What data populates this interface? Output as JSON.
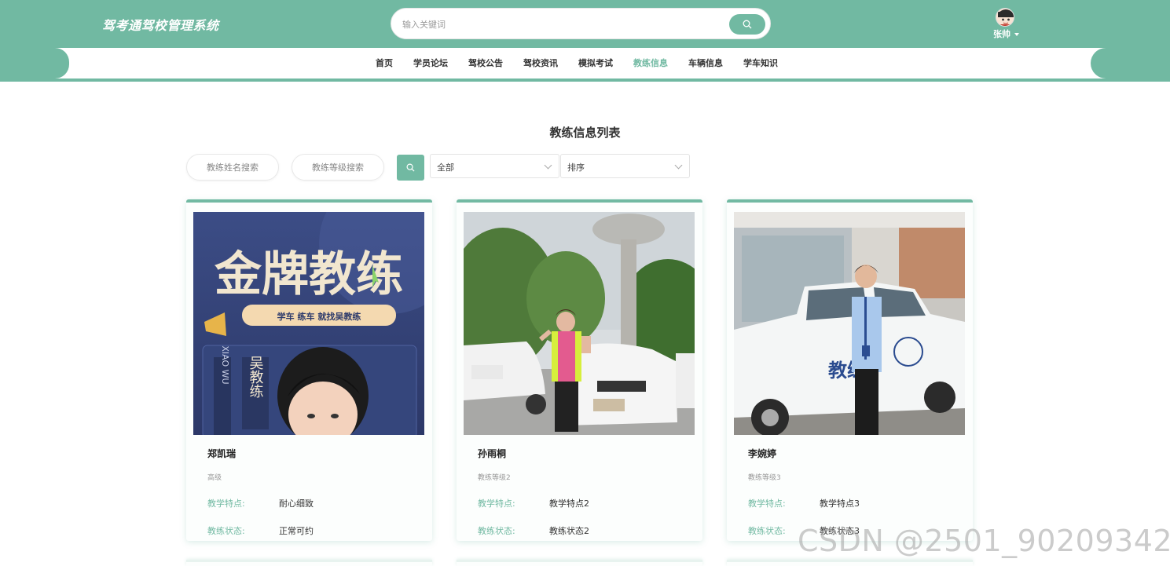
{
  "header": {
    "logo": "驾考通驾校管理系统",
    "search_placeholder": "输入关键词",
    "username": "张帅",
    "colors": {
      "primary": "#71b9a2",
      "background": "#ffffff"
    }
  },
  "nav": {
    "items": [
      {
        "label": "首页"
      },
      {
        "label": "学员论坛"
      },
      {
        "label": "驾校公告"
      },
      {
        "label": "驾校资讯"
      },
      {
        "label": "模拟考试"
      },
      {
        "label": "教练信息"
      },
      {
        "label": "车辆信息"
      },
      {
        "label": "学车知识"
      }
    ],
    "active": "教练信息"
  },
  "main": {
    "title": "教练信息列表",
    "filters": {
      "name_placeholder": "教练姓名搜索",
      "level_placeholder": "教练等级搜索",
      "select_all": "全部",
      "select_sort": "排序"
    },
    "cards": [
      {
        "name": "郑凯瑞",
        "level": "高级",
        "feature_label": "教学特点:",
        "feature": "耐心细致",
        "status_label": "教练状态:",
        "status": "正常可约",
        "photo": {
          "headline": "金牌教练",
          "slogan": "学车 练车 就找吴教练",
          "name_vertical": "吴教练",
          "pinyin": "XIAO WU"
        }
      },
      {
        "name": "孙雨桐",
        "level": "教练等级2",
        "feature_label": "教学特点:",
        "feature": "教学特点2",
        "status_label": "教练状态:",
        "status": "教练状态2"
      },
      {
        "name": "李婉婷",
        "level": "教练等级3",
        "feature_label": "教学特点:",
        "feature": "教学特点3",
        "status_label": "教练状态:",
        "status": "教练状态3",
        "photo": {
          "truck_text": "教练"
        }
      }
    ]
  },
  "watermark": "CSDN @2501_90209342"
}
